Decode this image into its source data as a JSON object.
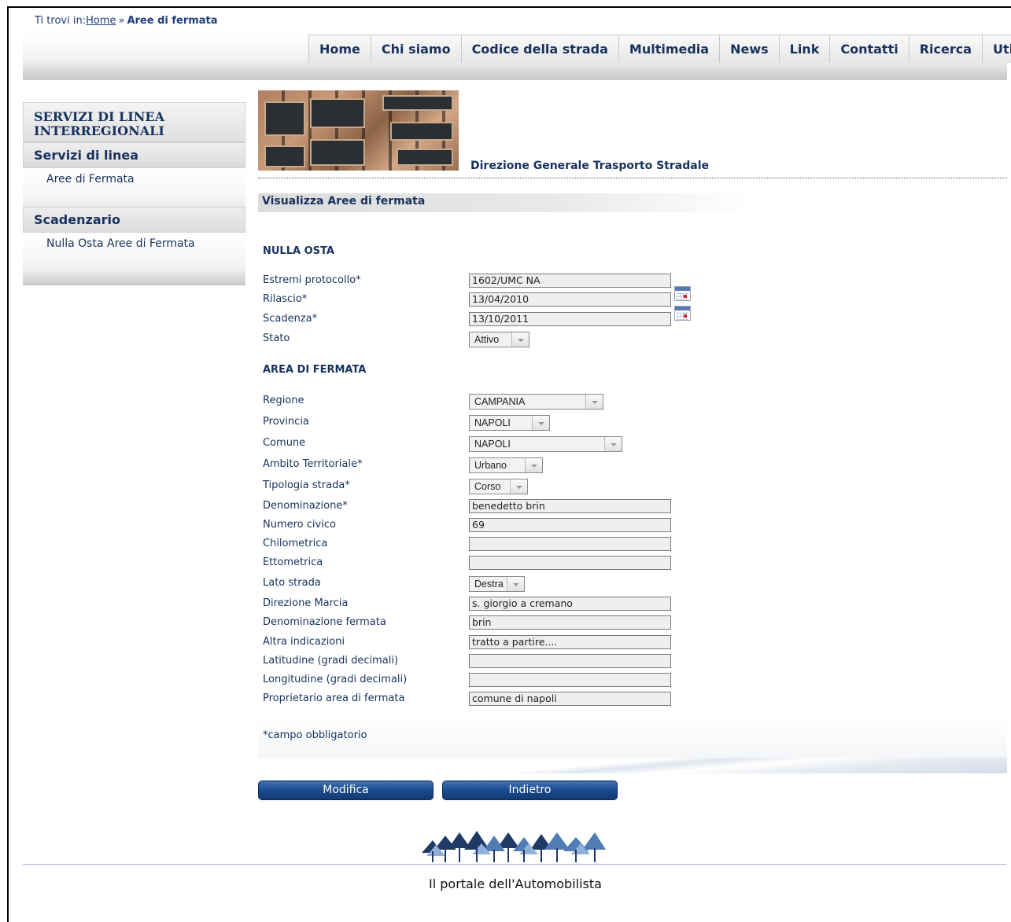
{
  "breadcrumb": {
    "prefix": "Ti trovi in:",
    "home": "Home",
    "separator": "»",
    "current": "Aree di fermata"
  },
  "nav": [
    "Home",
    "Chi siamo",
    "Codice della strada",
    "Multimedia",
    "News",
    "Link",
    "Contatti",
    "Ricerca",
    "Utilità"
  ],
  "sidebar": {
    "heading": "SERVIZI DI LINEA INTERREGIONALI",
    "sections": [
      {
        "title": "Servizi di linea",
        "links": [
          "Aree di Fermata"
        ]
      },
      {
        "title": "Scadenzario",
        "links": [
          "Nulla Osta Aree di Fermata"
        ]
      }
    ]
  },
  "org_title": "Direzione Generale Trasporto Stradale",
  "section_title": "Visualizza Aree di fermata",
  "groups": {
    "nulla_osta": "NULLA OSTA",
    "area_di_fermata": "AREA DI FERMATA"
  },
  "fields": {
    "estremi": {
      "label": "Estremi protocollo*",
      "value": "1602/UMC NA"
    },
    "rilascio": {
      "label": "Rilascio*",
      "value": "13/04/2010"
    },
    "scadenza": {
      "label": "Scadenza*",
      "value": "13/10/2011"
    },
    "stato": {
      "label": "Stato",
      "value": "Attivo"
    },
    "regione": {
      "label": "Regione",
      "value": "CAMPANIA"
    },
    "provincia": {
      "label": "Provincia",
      "value": "NAPOLI"
    },
    "comune": {
      "label": "Comune",
      "value": "NAPOLI"
    },
    "ambito": {
      "label": "Ambito Territoriale*",
      "value": "Urbano"
    },
    "tipologia": {
      "label": "Tipologia strada*",
      "value": "Corso"
    },
    "denominazione": {
      "label": "Denominazione*",
      "value": "benedetto brin"
    },
    "civico": {
      "label": "Numero civico",
      "value": "69"
    },
    "chilometrica": {
      "label": "Chilometrica",
      "value": ""
    },
    "ettometrica": {
      "label": "Ettometrica",
      "value": ""
    },
    "lato": {
      "label": "Lato strada",
      "value": "Destra"
    },
    "direzione": {
      "label": "Direzione Marcia",
      "value": "s. giorgio a cremano"
    },
    "den_fermata": {
      "label": "Denominazione fermata",
      "value": "brin"
    },
    "altra": {
      "label": "Altra indicazioni",
      "value": "tratto a partire...."
    },
    "latitudine": {
      "label": "Latitudine (gradi decimali)",
      "value": ""
    },
    "longitudine": {
      "label": "Longitudine (gradi decimali)",
      "value": ""
    },
    "proprietario": {
      "label": "Proprietario area di fermata",
      "value": "comune di napoli"
    }
  },
  "note": "*campo obbligatorio",
  "buttons": {
    "modifica": "Modifica",
    "indietro": "Indietro"
  },
  "footer": {
    "text": "Il portale dell'Automobilista"
  },
  "icons": {
    "calendar": "calendar-icon",
    "dropdown": "chevron-down-icon"
  },
  "colors": {
    "accent": "#17325e",
    "button": "#1c4a8c"
  }
}
